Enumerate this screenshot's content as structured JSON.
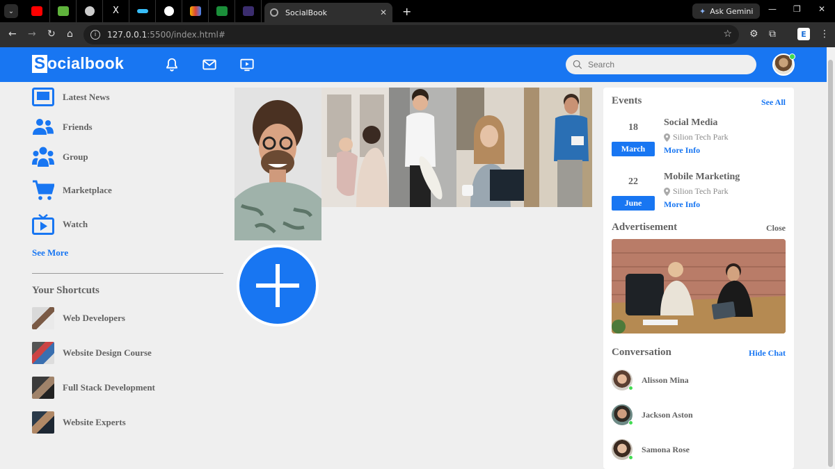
{
  "browser": {
    "active_tab_title": "SocialBook",
    "url_host": "127.0.0.1",
    "url_rest": ":5500/index.html#",
    "gemini_label": "Ask Gemini"
  },
  "navbar": {
    "logo_letter": "S",
    "logo_rest": "ocialbook",
    "search_placeholder": "Search"
  },
  "left_links": [
    {
      "label": "Latest News",
      "icon": "news-icon"
    },
    {
      "label": "Friends",
      "icon": "friends-icon"
    },
    {
      "label": "Group",
      "icon": "group-icon"
    },
    {
      "label": "Marketplace",
      "icon": "cart-icon"
    },
    {
      "label": "Watch",
      "icon": "tv-icon"
    }
  ],
  "see_more": "See More",
  "shortcuts_title": "Your Shortcuts",
  "shortcuts": [
    {
      "label": "Web Developers"
    },
    {
      "label": "Website Design Course"
    },
    {
      "label": "Full Stack Development"
    },
    {
      "label": "Website Experts"
    }
  ],
  "events": {
    "title": "Events",
    "see_all": "See All",
    "items": [
      {
        "day": "18",
        "month": "March",
        "name": "Social Media",
        "place": "Silion Tech Park",
        "more": "More Info"
      },
      {
        "day": "22",
        "month": "June",
        "name": "Mobile Marketing",
        "place": "Silion Tech Park",
        "more": "More Info"
      }
    ]
  },
  "advertisement": {
    "title": "Advertisement",
    "close": "Close"
  },
  "conversation": {
    "title": "Conversation",
    "hide": "Hide Chat",
    "people": [
      {
        "name": "Alisson Mina"
      },
      {
        "name": "Jackson Aston"
      },
      {
        "name": "Samona Rose"
      }
    ]
  },
  "colors": {
    "brand": "#1876f2",
    "online": "#41db51"
  }
}
